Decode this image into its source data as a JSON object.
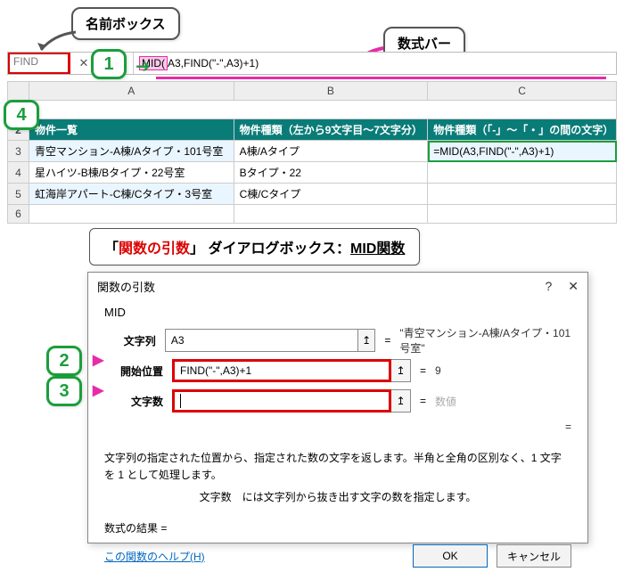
{
  "callouts": {
    "name_box": "名前ボックス",
    "formula_bar": "数式バー"
  },
  "name_box_value": "FIND",
  "formula_bar": {
    "prefix": "MID(",
    "rest": "A3,FIND(\"-\",A3)+1)"
  },
  "func_label": "【MID関数】",
  "columns": [
    "",
    "A",
    "B",
    "C"
  ],
  "header_row": {
    "a": "物件一覧",
    "b": "物件種類（左から9文字目～7文字分）",
    "c": "物件種類（「-」～「・」の間の文字）"
  },
  "rows": [
    {
      "n": "3",
      "a": "青空マンション-A棟/Aタイプ・101号室",
      "b": "A棟/Aタイプ",
      "c": "=MID(A3,FIND(\"-\",A3)+1)"
    },
    {
      "n": "4",
      "a": "星ハイツ-B棟/Bタイプ・22号室",
      "b": "Bタイプ・22",
      "c": ""
    },
    {
      "n": "5",
      "a": "虹海岸アパート-C棟/Cタイプ・3号室",
      "b": "C棟/Cタイプ",
      "c": ""
    },
    {
      "n": "6",
      "a": "",
      "b": "",
      "c": ""
    }
  ],
  "dlg_heading": {
    "brack_open": "「",
    "red": "関数の引数",
    "brack_close": "」",
    "mid": "ダイアログボックス：",
    "ul": "MID関数"
  },
  "dialog": {
    "title": "関数の引数",
    "func": "MID",
    "arg1_label": "文字列",
    "arg1_value": "A3",
    "arg1_result": "\"青空マンション-A棟/Aタイプ・101号室\"",
    "arg2_label": "開始位置",
    "arg2_value": "FIND(\"-\",A3)+1",
    "arg2_result": "9",
    "arg3_label": "文字数",
    "arg3_value": "",
    "arg3_result": "数値",
    "eq": "=",
    "desc": "文字列の指定された位置から、指定された数の文字を返します。半角と全角の区別なく、1 文字を 1 として処理します。",
    "desc2": "文字数　には文字列から抜き出す文字の数を指定します。",
    "result_label": "数式の結果 =",
    "help_link": "この関数のヘルプ(H)",
    "ok": "OK",
    "cancel": "キャンセル"
  },
  "badges": {
    "b1": "1",
    "b2": "2",
    "b3": "3",
    "b4": "4"
  }
}
